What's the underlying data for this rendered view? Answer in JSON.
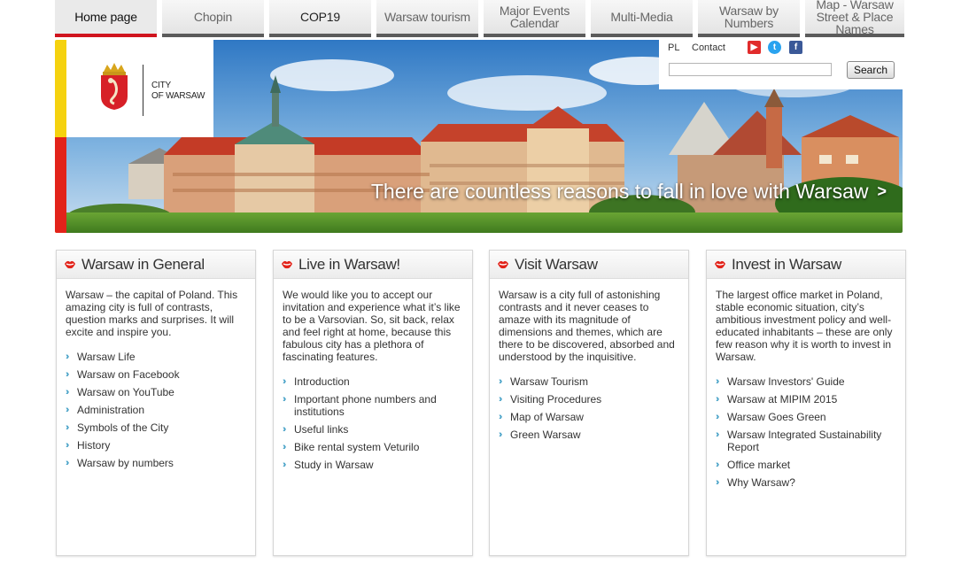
{
  "nav": [
    {
      "label": "Home page",
      "active": true
    },
    {
      "label": "Chopin"
    },
    {
      "label": "COP19"
    },
    {
      "label": "Warsaw tourism"
    },
    {
      "label": "Major Events Calendar"
    },
    {
      "label": "Multi-Media"
    },
    {
      "label": "Warsaw by Numbers"
    },
    {
      "label": "Map - Warsaw Street & Place Names"
    }
  ],
  "logo": {
    "line1": "City",
    "line2": "of Warsaw"
  },
  "banner": {
    "slogan": "There are countless reasons to fall in love with Warsaw",
    "arrow": ">"
  },
  "tools": {
    "lang": "PL",
    "contact": "Contact",
    "social": {
      "youtube": "▶",
      "twitter": "t",
      "facebook": "f"
    },
    "search_value": "",
    "search_button": "Search"
  },
  "columns": [
    {
      "title": "Warsaw in General",
      "intro": "Warsaw – the capital of Poland. This amazing city is full of contrasts, question marks and surprises. It will excite and inspire you.",
      "links": [
        "Warsaw Life",
        "Warsaw on Facebook",
        "Warsaw on YouTube",
        "Administration",
        "Symbols of the City",
        "History",
        "Warsaw by numbers"
      ]
    },
    {
      "title": "Live in Warsaw!",
      "intro": "We would like you to accept our invitation and experience what it’s like to be a Varsovian. So, sit back, relax and feel right at home, because this fabulous city has a plethora of fascinating features.",
      "links": [
        "Introduction",
        "Important phone numbers and institutions",
        "Useful links",
        "Bike rental system Veturilo",
        "Study in Warsaw"
      ]
    },
    {
      "title": "Visit Warsaw",
      "intro": "Warsaw is a city full of astonishing contrasts and it never ceases to amaze with its magnitude of dimensions and themes, which are there to be discovered, absorbed and understood by the inquisitive.",
      "links": [
        "Warsaw Tourism",
        "Visiting Procedures",
        "Map of Warsaw",
        "Green Warsaw"
      ]
    },
    {
      "title": "Invest in Warsaw",
      "intro": "The largest office market in Poland, stable economic situation, city’s ambitious investment policy and well-educated inhabitants – these are only few reason why it is worth to invest in Warsaw.",
      "links": [
        "Warsaw Investors' Guide",
        "Warsaw at MIPIM 2015",
        "Warsaw Goes Green",
        "Warsaw Integrated Sustainability Report",
        "Office market",
        "Why Warsaw?"
      ]
    }
  ],
  "colors": {
    "accent": "#d0141e",
    "link_arrow": "#4aa3c8",
    "brand_yellow": "#f5d20f"
  }
}
